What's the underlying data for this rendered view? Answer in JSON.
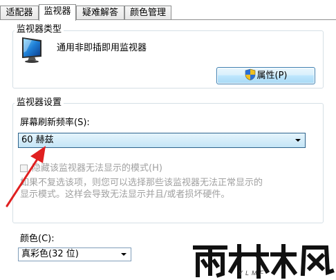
{
  "tabs": [
    {
      "label": "适配器",
      "active": false
    },
    {
      "label": "监视器",
      "active": true
    },
    {
      "label": "疑难解答",
      "active": false
    },
    {
      "label": "颜色管理",
      "active": false
    }
  ],
  "monitor_type": {
    "group_title": "监视器类型",
    "monitor_name": "通用非即插即用监视器",
    "properties_button": "属性(P)"
  },
  "monitor_settings": {
    "group_title": "监视器设置",
    "refresh_label": "屏幕刷新频率(S):",
    "refresh_value": "60 赫兹",
    "hide_modes_label": "隐藏该监视器无法显示的模式(H)",
    "hide_modes_checked": false,
    "hide_modes_enabled": false,
    "description_line1": "如果不复选该项，则您可以选择那些该监视器无法正常显示的",
    "description_line2": "显示模式。这样会导致无法显示并且/或者损坏硬件。"
  },
  "colors": {
    "label": "颜色(C):",
    "value": "真彩色(32 位)"
  },
  "watermark": {
    "logo_text": "雨林木风",
    "sub_text": "YLMF"
  },
  "theme": {
    "annotation_color": "#e02020",
    "button_border": "#3c7fb1",
    "focus_border": "#2c628b"
  }
}
